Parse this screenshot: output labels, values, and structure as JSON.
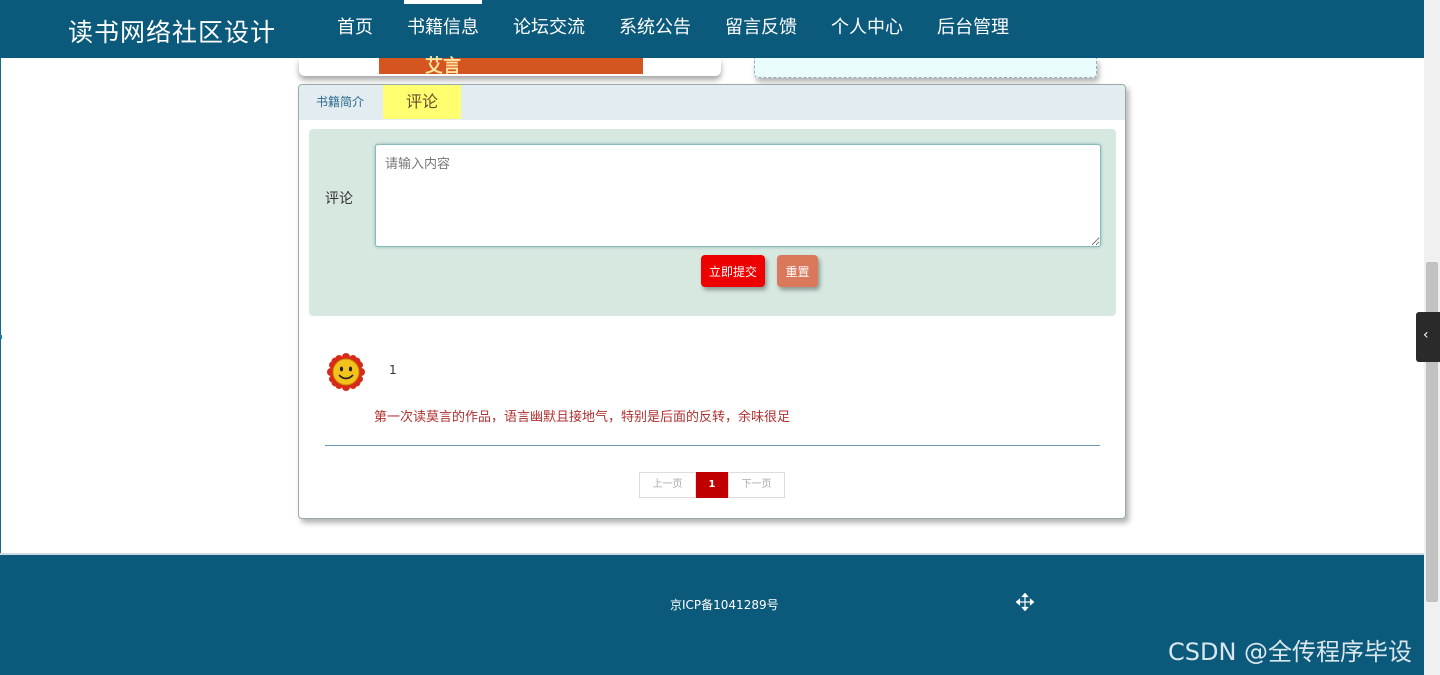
{
  "header": {
    "title": "读书网络社区设计",
    "nav": [
      {
        "label": "首页"
      },
      {
        "label": "书籍信息",
        "active": true
      },
      {
        "label": "论坛交流"
      },
      {
        "label": "系统公告"
      },
      {
        "label": "留言反馈"
      },
      {
        "label": "个人中心"
      },
      {
        "label": "后台管理"
      }
    ]
  },
  "book_cover": {
    "title_fragment": "艾言"
  },
  "tabs": {
    "intro_label": "书籍简介",
    "comment_label": "评论",
    "active": "评论"
  },
  "comment_form": {
    "label": "评论",
    "placeholder": "请输入内容",
    "value": "",
    "submit_label": "立即提交",
    "reset_label": "重置"
  },
  "comments": [
    {
      "avatar_icon": "smiling-sun-avatar-icon",
      "user": "1",
      "text": "第一次读莫言的作品，语言幽默且接地气，特别是后面的反转，余味很足"
    }
  ],
  "pagination": {
    "prev_label": "上一页",
    "current_page": "1",
    "next_label": "下一页"
  },
  "footer": {
    "icp": "京ICP备1041289号"
  },
  "watermark": "CSDN @全传程序毕设",
  "colors": {
    "header_bg": "#0b5a7c",
    "active_tab": "#ffff70",
    "submit": "#ee0000",
    "reset": "#d9785a",
    "page_current": "#c00000"
  },
  "icons": {
    "cursor": "move-cursor-icon",
    "sidebar_toggle": "chevron-left-icon"
  }
}
